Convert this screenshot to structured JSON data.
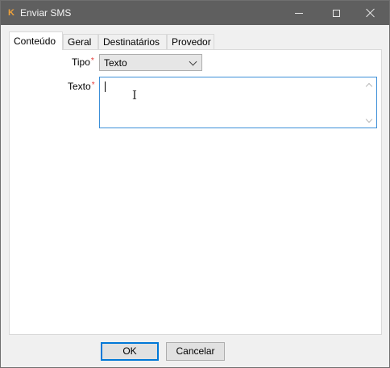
{
  "window": {
    "title": "Enviar SMS",
    "app_icon": "K"
  },
  "tabs": [
    {
      "label": "Conteúdo",
      "active": true
    },
    {
      "label": "Geral",
      "active": false
    },
    {
      "label": "Destinatários",
      "active": false
    },
    {
      "label": "Provedor",
      "active": false
    }
  ],
  "form": {
    "tipo": {
      "label": "Tipo",
      "required_mark": "*",
      "value": "Texto"
    },
    "texto": {
      "label": "Texto",
      "required_mark": "*",
      "value": ""
    }
  },
  "buttons": {
    "ok": "OK",
    "cancel": "Cancelar"
  },
  "colors": {
    "titlebar": "#5f5f5f",
    "required": "#e53935",
    "focus_border": "#3c8fd8",
    "default_button_border": "#0078d7"
  }
}
